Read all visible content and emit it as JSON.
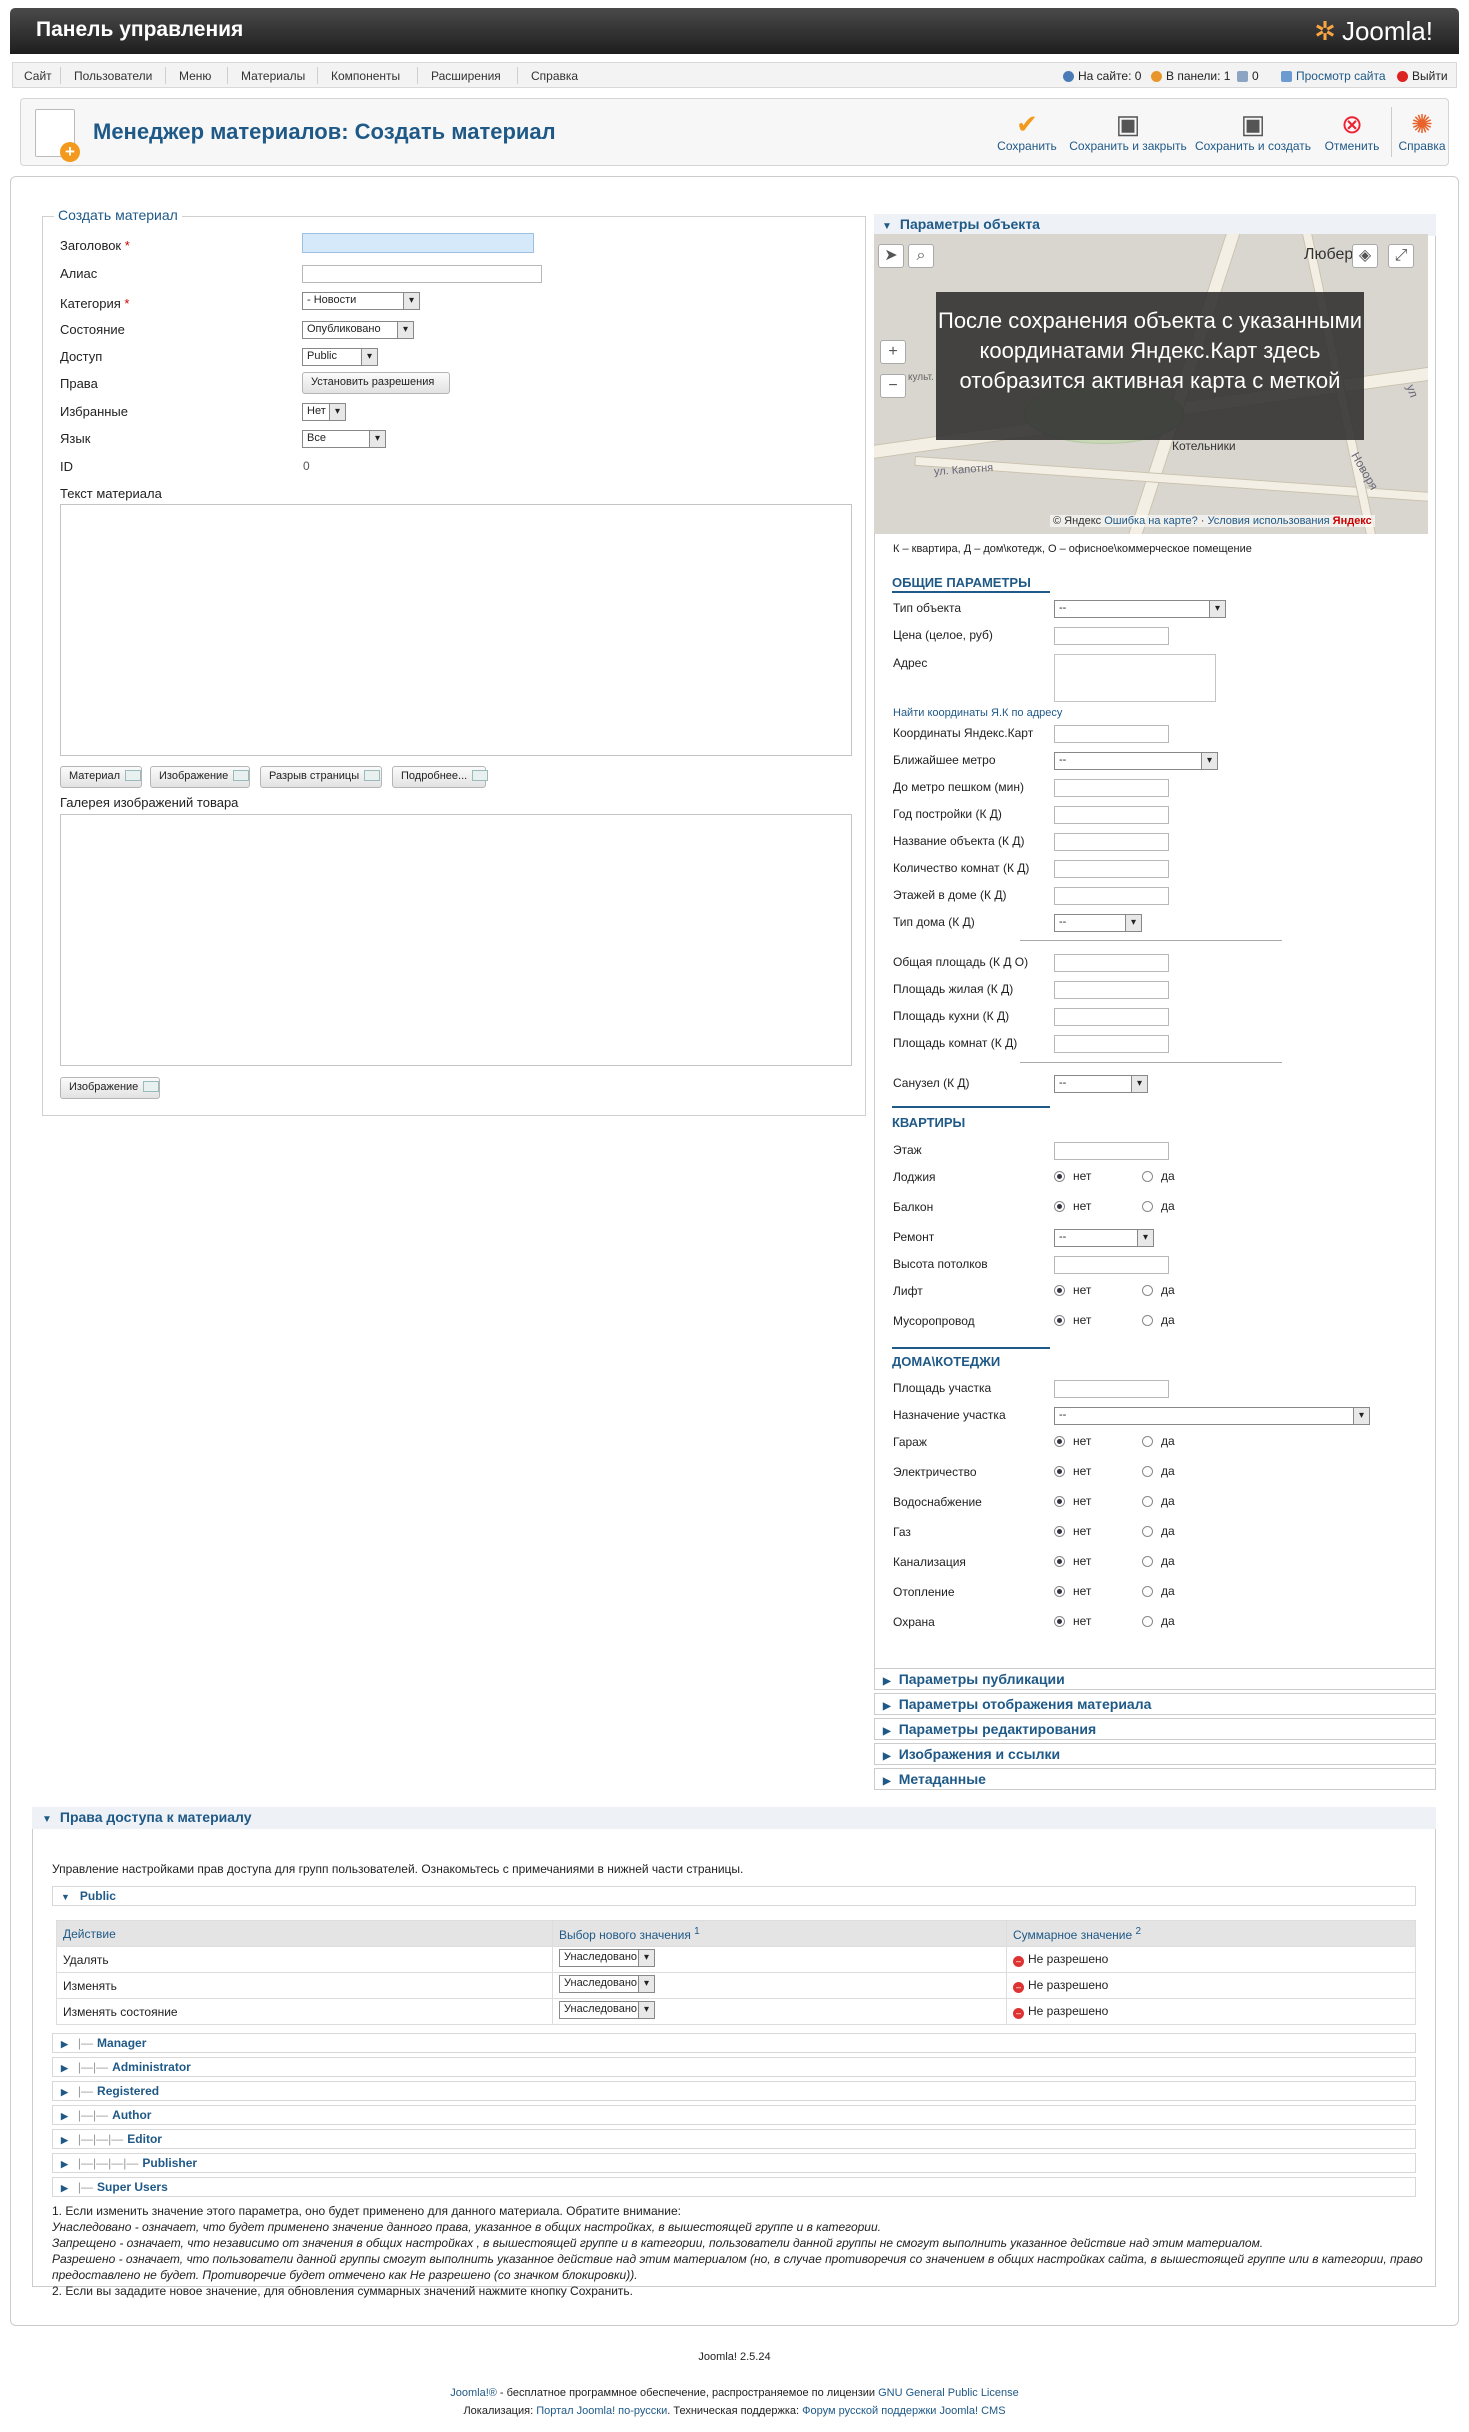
{
  "header": {
    "title": "Панель управления",
    "logo_text": "Joomla!"
  },
  "menu": {
    "items": [
      "Сайт",
      "Пользователи",
      "Меню",
      "Материалы",
      "Компоненты",
      "Расширения",
      "Справка"
    ],
    "status": {
      "on_site": "На сайте: 0",
      "in_panel": "В панели: 1",
      "messages": "0",
      "view_site": "Просмотр сайта",
      "logout": "Выйти"
    }
  },
  "toolbar": {
    "page_title": "Менеджер материалов: Создать материал",
    "buttons": {
      "save": "Сохранить",
      "save_close": "Сохранить и закрыть",
      "save_new": "Сохранить и создать",
      "cancel": "Отменить",
      "help": "Справка"
    }
  },
  "form": {
    "legend": "Создать материал",
    "title_label": "Заголовок",
    "alias_label": "Алиас",
    "category_label": "Категория",
    "category_value": "- Новости",
    "state_label": "Состояние",
    "state_value": "Опубликовано",
    "access_label": "Доступ",
    "access_value": "Public",
    "rights_label": "Права",
    "rights_button": "Установить разрешения",
    "featured_label": "Избранные",
    "featured_value": "Нет",
    "language_label": "Язык",
    "language_value": "Все",
    "id_label": "ID",
    "id_value": "0",
    "text_label": "Текст материала",
    "editor_buttons": {
      "article": "Материал",
      "image": "Изображение",
      "pagebreak": "Разрыв страницы",
      "readmore": "Подробнее..."
    },
    "gallery_label": "Галерея изображений товара",
    "gallery_image_button": "Изображение"
  },
  "object_params": {
    "title": "Параметры объекта",
    "map": {
      "overlay": "После сохранения объекта с указанными координатами Яндекс.Карт здесь отобразится активная карта с меткой",
      "place_labels": {
        "lyubertsy": "Любер",
        "kotelniki": "Котельники",
        "kapotnya": "ул. Капотня",
        "novorya": "Новоря",
        "ulitsa": "ул",
        "kultury": "культ."
      },
      "copyright": "© Яндекс",
      "error_link": "Ошибка на карте?",
      "terms_link": "Условия использования",
      "brand": "Яндекс"
    },
    "legend_text": "К – квартира, Д – дом\\котедж, О – офисное\\коммерческое помещение",
    "general": {
      "title": "ОБЩИЕ ПАРАМЕТРЫ",
      "type": "Тип объекта",
      "type_value": "--",
      "price": "Цена (целое, руб)",
      "address": "Адрес",
      "find_coords": "Найти координаты Я.К по адресу",
      "coords": "Координаты Яндекс.Карт",
      "metro": "Ближайшее метро",
      "metro_value": "--",
      "walk": "До метро пешком (мин)",
      "year": "Год постройки (К Д)",
      "name": "Название объекта (К Д)",
      "rooms": "Количество комнат (К Д)",
      "floors": "Этажей в доме (К Д)",
      "house_type": "Тип дома (К Д)",
      "house_type_value": "--",
      "total_area": "Общая площадь (К Д О)",
      "living_area": "Площадь жилая (К Д)",
      "kitchen_area": "Площадь кухни (К Д)",
      "rooms_area": "Площадь комнат (К Д)",
      "bathroom": "Санузел (К Д)",
      "bathroom_value": "--"
    },
    "flats": {
      "title": "КВАРТИРЫ",
      "floor": "Этаж",
      "loggia": "Лоджия",
      "balcony": "Балкон",
      "repair": "Ремонт",
      "repair_value": "--",
      "ceiling": "Высота потолков",
      "lift": "Лифт",
      "garbage": "Мусоропровод"
    },
    "houses": {
      "title": "ДОМА\\КОТЕДЖИ",
      "plot_area": "Площадь участка",
      "plot_purpose": "Назначение участка",
      "plot_purpose_value": "--",
      "garage": "Гараж",
      "electricity": "Электричество",
      "water": "Водоснабжение",
      "gas": "Газ",
      "sewer": "Канализация",
      "heating": "Отопление",
      "security": "Охрана"
    },
    "radio_no": "нет",
    "radio_yes": "да"
  },
  "sliders": {
    "publication": "Параметры публикации",
    "display": "Параметры отображения материала",
    "editing": "Параметры редактирования",
    "images": "Изображения и ссылки",
    "metadata": "Метаданные"
  },
  "permissions": {
    "title": "Права доступа к материалу",
    "intro": "Управление настройками прав доступа для групп пользователей. Ознакомьтесь с примечаниями в нижней части страницы.",
    "public_group": "Public",
    "headers": {
      "action": "Действие",
      "select": "Выбор нового значения",
      "select_sup": "1",
      "calc": "Суммарное значение",
      "calc_sup": "2"
    },
    "rows": [
      {
        "action": "Удалять",
        "value": "Унаследовано",
        "calc": "Не разрешено"
      },
      {
        "action": "Изменять",
        "value": "Унаследовано",
        "calc": "Не разрешено"
      },
      {
        "action": "Изменять состояние",
        "value": "Унаследовано",
        "calc": "Не разрешено"
      }
    ],
    "groups": [
      {
        "tree": "|—",
        "name": "Manager"
      },
      {
        "tree": "|—|—",
        "name": "Administrator"
      },
      {
        "tree": "|—",
        "name": "Registered"
      },
      {
        "tree": "|—|—",
        "name": "Author"
      },
      {
        "tree": "|—|—|—",
        "name": "Editor"
      },
      {
        "tree": "|—|—|—|—",
        "name": "Publisher"
      },
      {
        "tree": "|—",
        "name": "Super Users"
      }
    ],
    "notes": [
      "1. Если изменить значение этого параметра, оно будет применено для данного материала. Обратите внимание:",
      "Унаследовано - означает, что будет применено значение данного права, указанное в общих настройках, в вышестоящей группе и в категории.",
      "Запрещено - означает, что независимо от значения в общих настройках , в вышестоящей группе и в категории, пользователи данной группы не смогут выполнить указанное действие над этим материалом.",
      "Разрешено - означает, что пользователи данной группы смогут выполнить указанное действие над этим материалом (но, в случае противоречия со значением в общих настройках сайта, в вышестоящей группе или в категории, право предоставлено не будет. Противоречие будет отмечено как Не разрешено (со значком блокировки)).",
      "2. Если вы зададите новое значение, для обновления суммарных значений нажмите кнопку Сохранить."
    ]
  },
  "footer": {
    "version": "Joomla! 2.5.24",
    "line1_a": "Joomla!®",
    "line1_b": " - бесплатное программное обеспечение, распространяемое по лицензии ",
    "line1_c": "GNU General Public License",
    "line2_a": "Локализация: ",
    "line2_b": "Портал Joomla! по-русски",
    "line2_c": ". Техническая поддержка: ",
    "line2_d": "Форум русской поддержки Joomla! CMS"
  }
}
